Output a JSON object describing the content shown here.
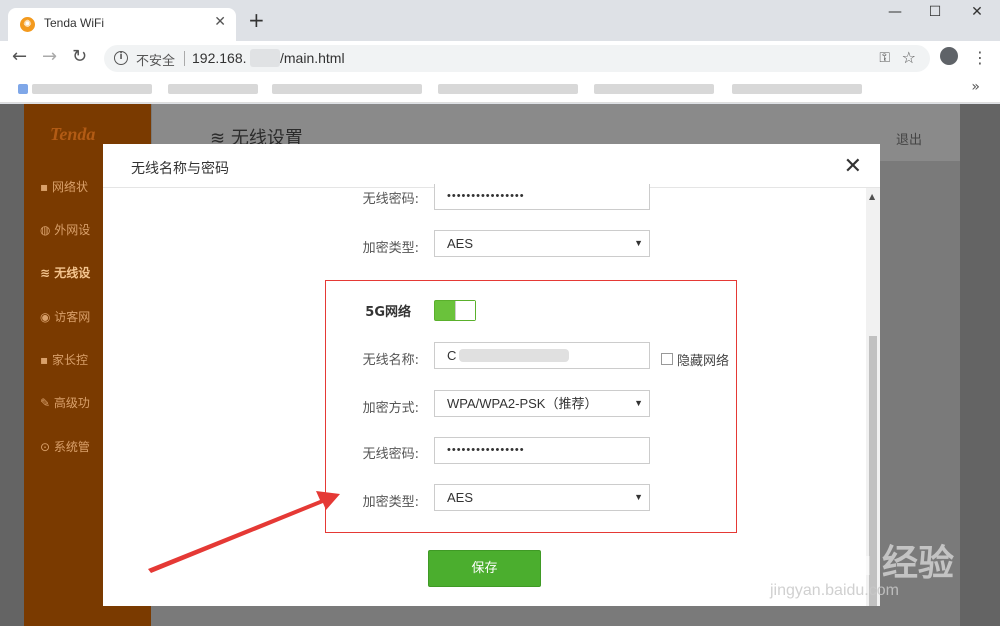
{
  "browser": {
    "tab_title": "Tenda WiFi",
    "tab_close": "✕",
    "new_tab": "+",
    "insecure_label": "不安全",
    "url_prefix": "192.168.",
    "url_suffix": "/main.html",
    "bookmarks_more": "»"
  },
  "app": {
    "logo": "Tenda",
    "page_title": "无线设置",
    "logout": "退出",
    "sidebar": [
      {
        "label": "网络状",
        "icon": "status-icon"
      },
      {
        "label": "外网设",
        "icon": "globe-icon"
      },
      {
        "label": "无线设",
        "icon": "wifi-icon",
        "active": true
      },
      {
        "label": "访客网",
        "icon": "guest-icon"
      },
      {
        "label": "家长控",
        "icon": "parent-icon"
      },
      {
        "label": "高级功",
        "icon": "wrench-icon"
      },
      {
        "label": "系统管",
        "icon": "system-icon"
      }
    ]
  },
  "modal": {
    "title": "无线名称与密码",
    "close": "✕",
    "upper": {
      "password_label": "无线密码:",
      "password_value": "••••••••••••••••",
      "encryption_type_label": "加密类型:",
      "encryption_type_value": "AES"
    },
    "band_5g": {
      "label": "5G网络",
      "enabled": true,
      "ssid_label": "无线名称:",
      "ssid_value": "C",
      "hide_network_label": "隐藏网络",
      "security_mode_label": "加密方式:",
      "security_mode_value": "WPA/WPA2-PSK（推荐）",
      "password_label": "无线密码:",
      "password_value": "••••••••••••••••",
      "encryption_type_label": "加密类型:",
      "encryption_type_value": "AES"
    },
    "save_label": "保存"
  },
  "watermark": {
    "brand": "Bai du 经验",
    "url": "jingyan.baidu.com"
  },
  "colors": {
    "accent_green": "#4bae2e",
    "highlight_red": "#e53935",
    "sidebar_brown": "#7a3a00"
  }
}
